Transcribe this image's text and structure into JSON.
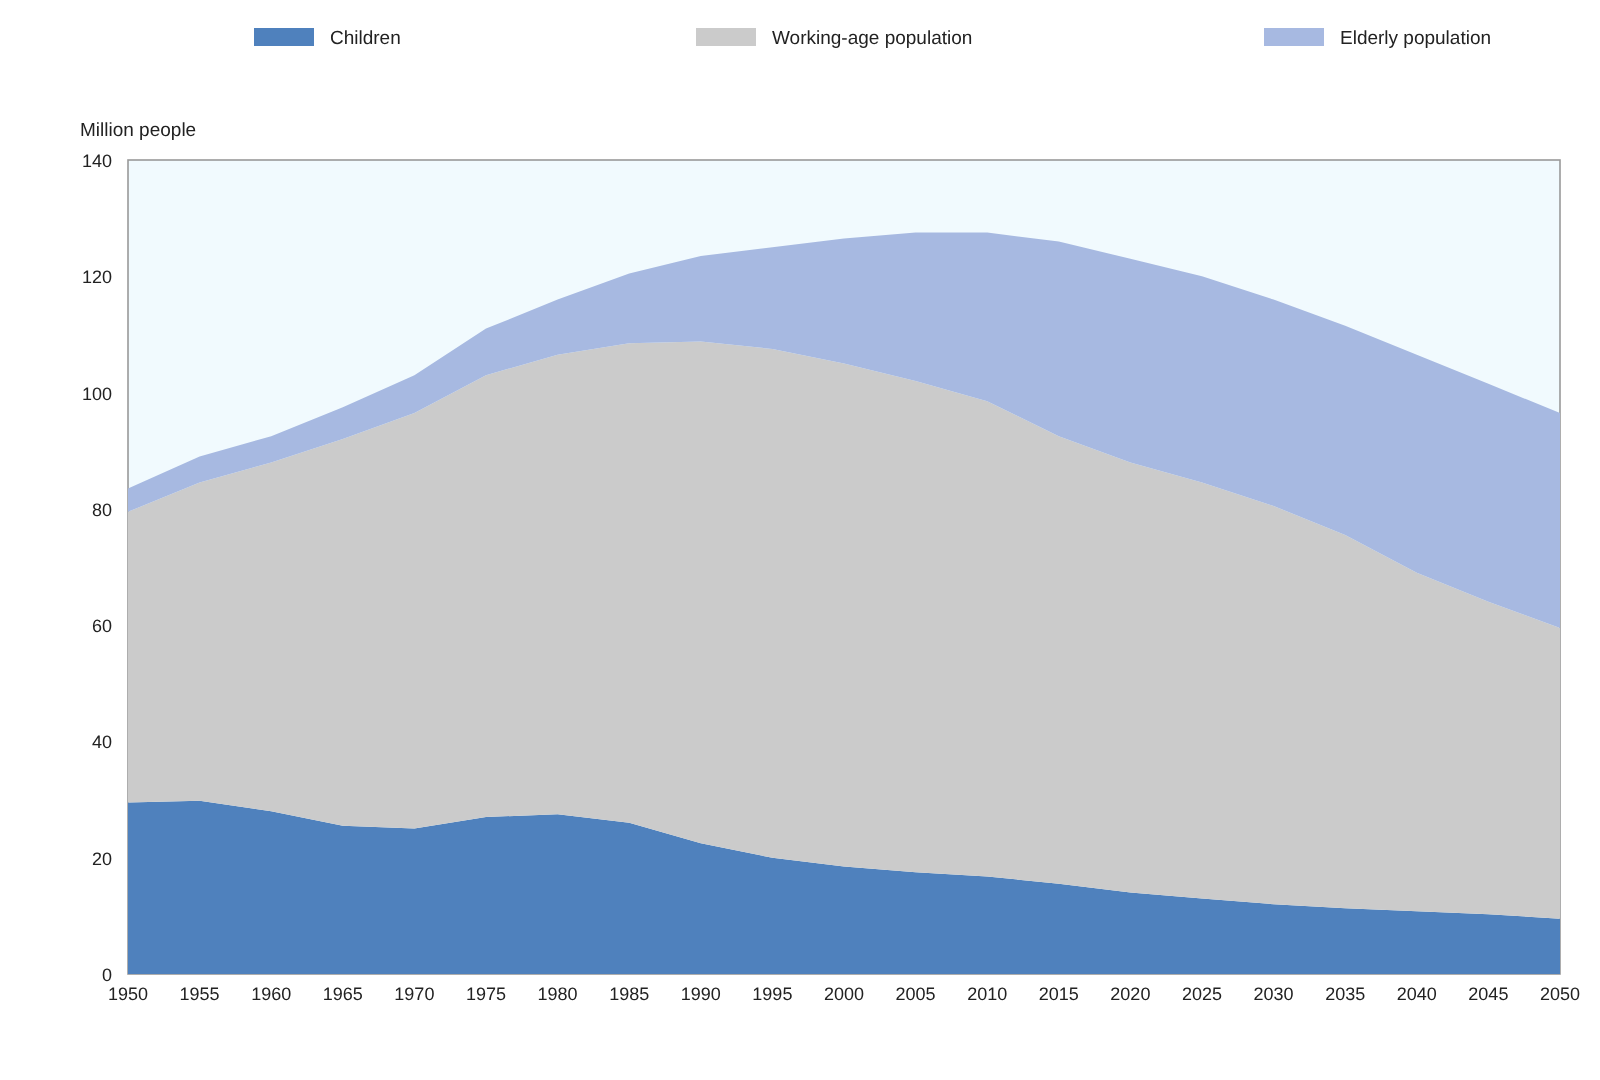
{
  "chart": {
    "chart_data": {
      "type": "area",
      "ylabel": "Million people",
      "stacked": true,
      "legend": "top",
      "x": [
        1950,
        1955,
        1960,
        1965,
        1970,
        1975,
        1980,
        1985,
        1990,
        1995,
        2000,
        2005,
        2010,
        2015,
        2020,
        2025,
        2030,
        2035,
        2040,
        2045,
        2050
      ],
      "series": [
        {
          "name": "Children",
          "color": "#4f81bd",
          "values": [
            29.5,
            29.8,
            28,
            25.5,
            25,
            27,
            27.5,
            26,
            22.5,
            20,
            18.5,
            17.5,
            16.8,
            15.5,
            14,
            13,
            12,
            11.3,
            10.8,
            10.3,
            9.5
          ]
        },
        {
          "name": "Working-age population",
          "color": "#cbcbcb",
          "values": [
            50,
            54.7,
            60,
            66.5,
            71.5,
            76,
            79,
            82.5,
            86.3,
            87.5,
            86.5,
            84.5,
            81.7,
            77,
            74,
            71.5,
            68.5,
            64.2,
            58.2,
            53.7,
            50
          ]
        },
        {
          "name": "Elderly population",
          "color": "#a7b9e1",
          "values": [
            4,
            4.5,
            4.5,
            5.5,
            6.5,
            8,
            9.5,
            12,
            14.7,
            17.5,
            21.5,
            25.5,
            29,
            33.5,
            35,
            35.5,
            35.5,
            36,
            37.5,
            37.5,
            37
          ]
        }
      ],
      "xlim": [
        1950,
        2050
      ],
      "ylim": [
        0,
        140
      ],
      "xticks": [
        1950,
        1955,
        1960,
        1965,
        1970,
        1975,
        1980,
        1985,
        1990,
        1995,
        2000,
        2005,
        2010,
        2015,
        2020,
        2025,
        2030,
        2035,
        2040,
        2045,
        2050
      ],
      "yticks": [
        0,
        20,
        40,
        60,
        80,
        100,
        120,
        140
      ]
    }
  }
}
